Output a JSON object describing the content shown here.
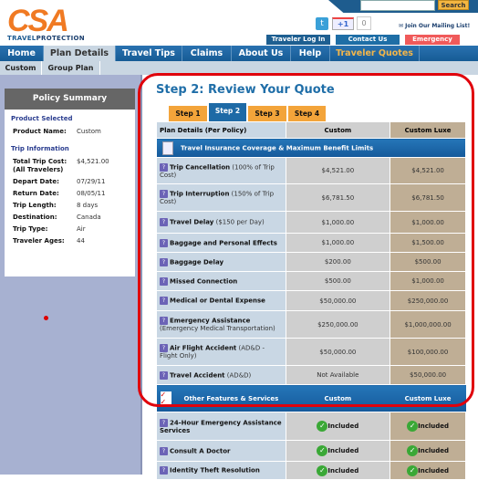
{
  "header": {
    "logo": "CSA",
    "logo_sub_light": "TRAVEL",
    "logo_sub_bold": "PROTECTION",
    "search_button": "Search",
    "gplus": "+1",
    "gplus_count": "0",
    "mailing": "Join Our Mailing List!",
    "login": "Traveler Log In",
    "contact": "Contact Us",
    "emergency": "Emergency",
    "twitter": "t"
  },
  "colors": {
    "nav": "#1b5e9a",
    "emergency": "#f05a5a",
    "accent_orange": "#f3a43a",
    "highlight": "#e0000b"
  },
  "nav": [
    "Home",
    "Plan Details",
    "Travel Tips",
    "Claims",
    "About Us",
    "Help",
    "Traveler Quotes"
  ],
  "subnav": [
    "Custom",
    "Group Plan"
  ],
  "summary": {
    "title": "Policy Summary",
    "product_section": "Product Selected",
    "product_label": "Product Name:",
    "product_value": "Custom",
    "trip_section": "Trip Information",
    "rows": [
      {
        "l": "Total Trip Cost: (All Travelers)",
        "v": "$4,521.00"
      },
      {
        "l": "Depart Date:",
        "v": "07/29/11"
      },
      {
        "l": "Return Date:",
        "v": "08/05/11"
      },
      {
        "l": "Trip Length:",
        "v": "8 days"
      },
      {
        "l": "Destination:",
        "v": "Canada"
      },
      {
        "l": "Trip Type:",
        "v": "Air"
      },
      {
        "l": "Traveler Ages:",
        "v": "44"
      }
    ]
  },
  "main": {
    "title": "Step 2: Review Your Quote",
    "tabs": [
      "Step 1",
      "Step 2",
      "Step 3",
      "Step 4"
    ],
    "active_tab": 1,
    "table": {
      "col1": "Plan Details (Per Policy)",
      "col2": "Custom",
      "col3": "Custom Luxe",
      "band": "Travel Insurance Coverage & Maximum Benefit Limits",
      "rows": [
        {
          "name": "Trip Cancellation",
          "note": "(100% of Trip Cost)",
          "a": "$4,521.00",
          "b": "$4,521.00"
        },
        {
          "name": "Trip Interruption",
          "note": "(150% of Trip Cost)",
          "a": "$6,781.50",
          "b": "$6,781.50"
        },
        {
          "name": "Travel Delay",
          "note": "($150 per Day)",
          "a": "$1,000.00",
          "b": "$1,000.00"
        },
        {
          "name": "Baggage and Personal Effects",
          "note": "",
          "a": "$1,000.00",
          "b": "$1,500.00"
        },
        {
          "name": "Baggage Delay",
          "note": "",
          "a": "$200.00",
          "b": "$500.00"
        },
        {
          "name": "Missed Connection",
          "note": "",
          "a": "$500.00",
          "b": "$1,000.00"
        },
        {
          "name": "Medical or Dental Expense",
          "note": "",
          "a": "$50,000.00",
          "b": "$250,000.00"
        },
        {
          "name": "Emergency Assistance",
          "note": "(Emergency Medical Transportation)",
          "a": "$250,000.00",
          "b": "$1,000,000.00"
        },
        {
          "name": "Air Flight Accident",
          "note": "(AD&D - Flight Only)",
          "a": "$50,000.00",
          "b": "$100,000.00"
        },
        {
          "name": "Travel Accident",
          "note": "(AD&D)",
          "a": "Not Available",
          "b": "$50,000.00"
        }
      ],
      "band2": "Other Features & Services",
      "band2_c2": "Custom",
      "band2_c3": "Custom Luxe",
      "features": [
        {
          "name": "24-Hour Emergency Assistance Services",
          "a": "Included",
          "b": "Included"
        },
        {
          "name": "Consult A Doctor",
          "a": "Included",
          "b": "Included"
        },
        {
          "name": "Identity Theft Resolution",
          "a": "Included",
          "b": "Included"
        }
      ]
    }
  }
}
